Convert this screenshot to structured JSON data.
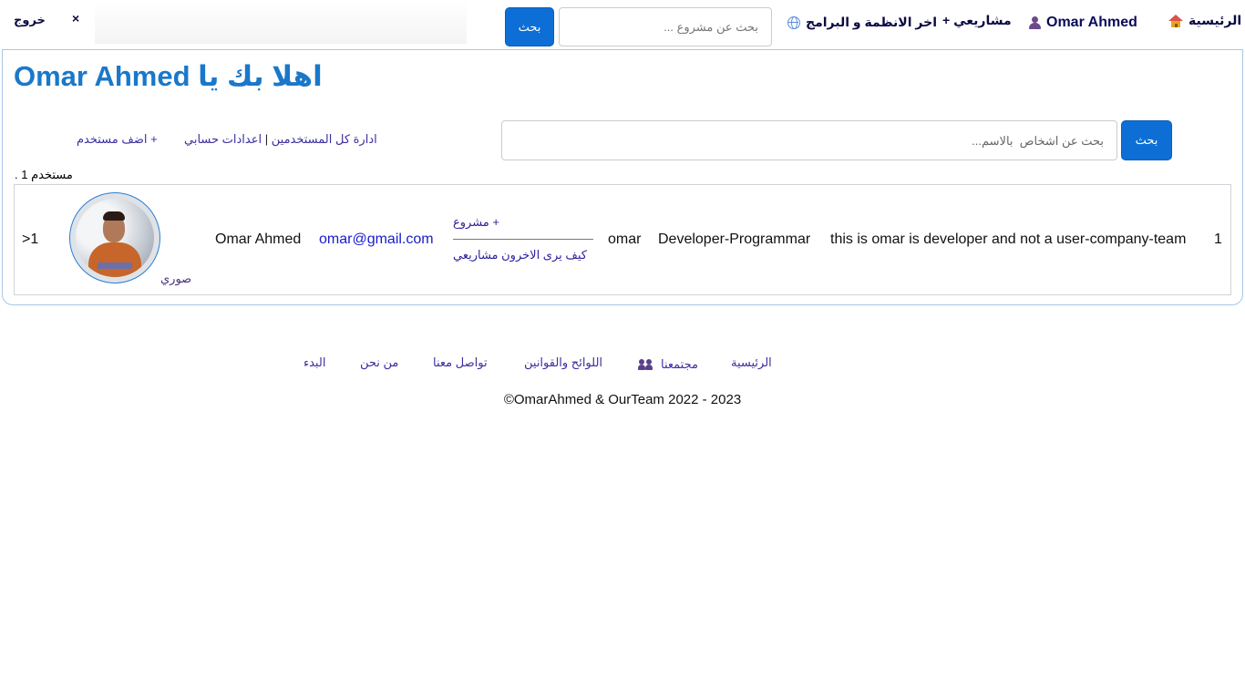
{
  "nav": {
    "home_label": "الرئيسية",
    "user_name": "Omar Ahmed",
    "my_projects_label": "مشاريعي +",
    "latest_systems_label": "اخر الانظمة و البرامج",
    "search_placeholder": "بحث عن مشروع ...",
    "search_button": "بحث",
    "close_symbol": "×",
    "logout_label": "خروج"
  },
  "main": {
    "welcome_title": "اهلا بك يا Omar Ahmed",
    "manage_users_label": "ادارة كل المستخدمين",
    "separator": "|",
    "account_settings_label": "اعدادات حسابي",
    "add_user_label": "+ اضف مستخدم",
    "user_search_placeholder": "بحث عن اشخاص  بالاسم...",
    "user_search_button": "بحث",
    "user_count_text": "مستخدم 1 ."
  },
  "users": [
    {
      "index": "1",
      "description": "this is omar is developer and not a user-company-team",
      "role": "Developer-Programmar",
      "username": "omar",
      "add_project_label": "+ مشروع",
      "how_others_see_label": "كيف يرى الاخرون مشاريعي",
      "email": "omar@gmail.com",
      "full_name": "Omar Ahmed",
      "photos_label": "صوري",
      "next_label": ">1"
    }
  ],
  "footer": {
    "links": [
      "الرئيسية",
      "مجتمعنا",
      "اللوائح والقوانين",
      "تواصل معنا",
      "من نحن",
      "البدء"
    ],
    "copyright": "©OmarAhmed & OurTeam 2022 - 2023"
  },
  "colors": {
    "primary_button": "#0d6fd6",
    "welcome_text": "#1a78c9",
    "link_text": "#3b2fa0"
  }
}
